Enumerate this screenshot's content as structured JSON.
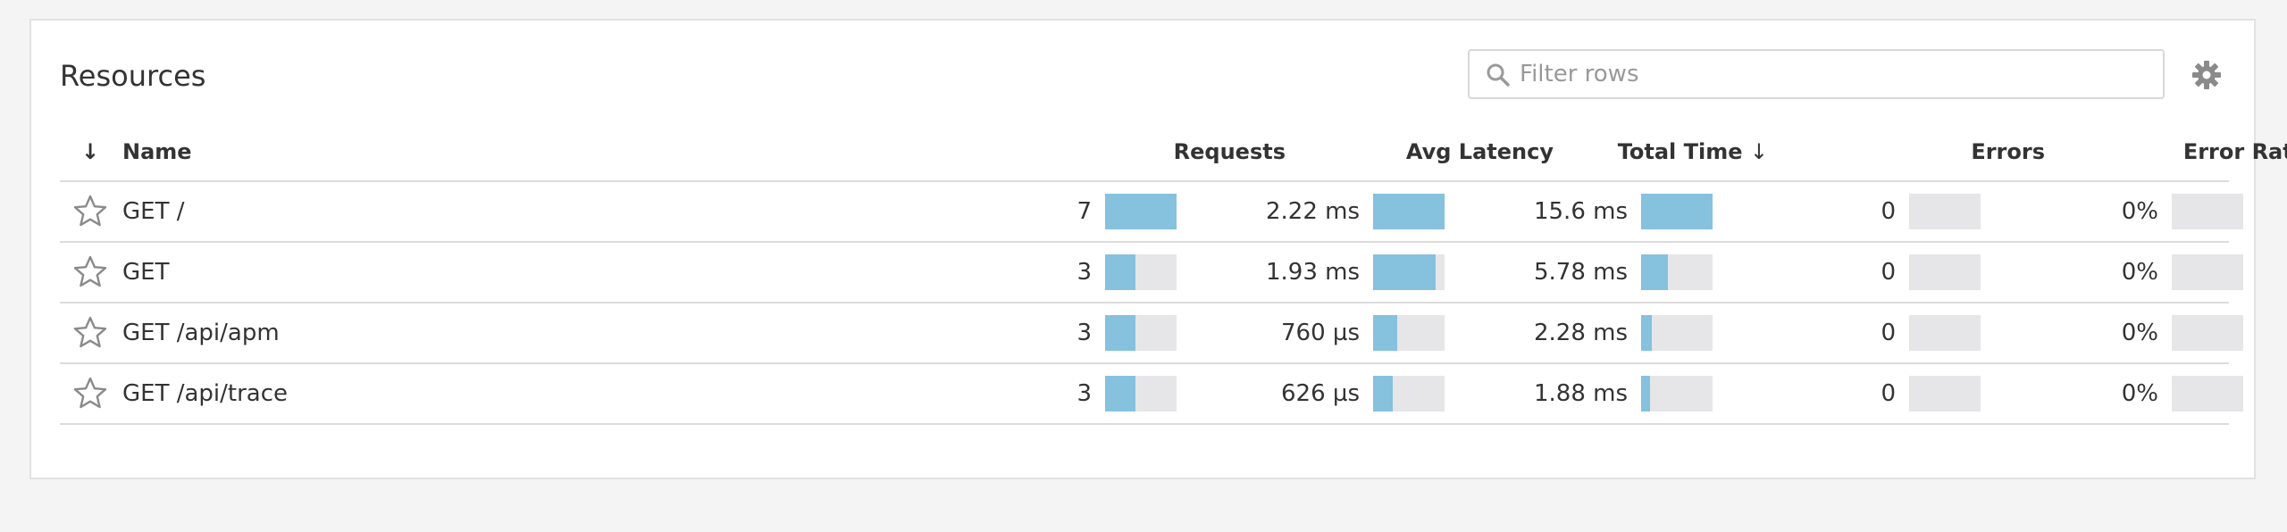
{
  "panel": {
    "title": "Resources",
    "filter": {
      "placeholder": "Filter rows",
      "value": ""
    },
    "settings_icon": "gear-icon",
    "search_icon": "search-icon"
  },
  "table": {
    "columns": {
      "sort_arrow": "↓",
      "name": "Name",
      "requests": "Requests",
      "avg_latency": "Avg Latency",
      "total_time": "Total Time",
      "total_time_sort": "↓",
      "errors": "Errors",
      "error_rate": "Error Rate"
    },
    "rows": [
      {
        "name": "GET /",
        "requests": "7",
        "requests_level": 1.0,
        "avg_latency": "2.22 ms",
        "avg_latency_level": 1.0,
        "total_time": "15.6 ms",
        "total_time_level": 1.0,
        "errors": "0",
        "errors_level": 0,
        "error_rate": "0%",
        "error_rate_level": 0
      },
      {
        "name": "GET",
        "requests": "3",
        "requests_level": 0.43,
        "avg_latency": "1.93 ms",
        "avg_latency_level": 0.87,
        "total_time": "5.78 ms",
        "total_time_level": 0.37,
        "errors": "0",
        "errors_level": 0,
        "error_rate": "0%",
        "error_rate_level": 0
      },
      {
        "name": "GET /api/apm",
        "requests": "3",
        "requests_level": 0.43,
        "avg_latency": "760 µs",
        "avg_latency_level": 0.34,
        "total_time": "2.28 ms",
        "total_time_level": 0.15,
        "errors": "0",
        "errors_level": 0,
        "error_rate": "0%",
        "error_rate_level": 0
      },
      {
        "name": "GET /api/trace",
        "requests": "3",
        "requests_level": 0.43,
        "avg_latency": "626 µs",
        "avg_latency_level": 0.28,
        "total_time": "1.88 ms",
        "total_time_level": 0.12,
        "errors": "0",
        "errors_level": 0,
        "error_rate": "0%",
        "error_rate_level": 0
      }
    ]
  },
  "colors": {
    "bar_fill": "#86c1de",
    "bar_track": "#e6e6e8",
    "border": "#dcdcdc",
    "background": "#f4f4f4"
  }
}
